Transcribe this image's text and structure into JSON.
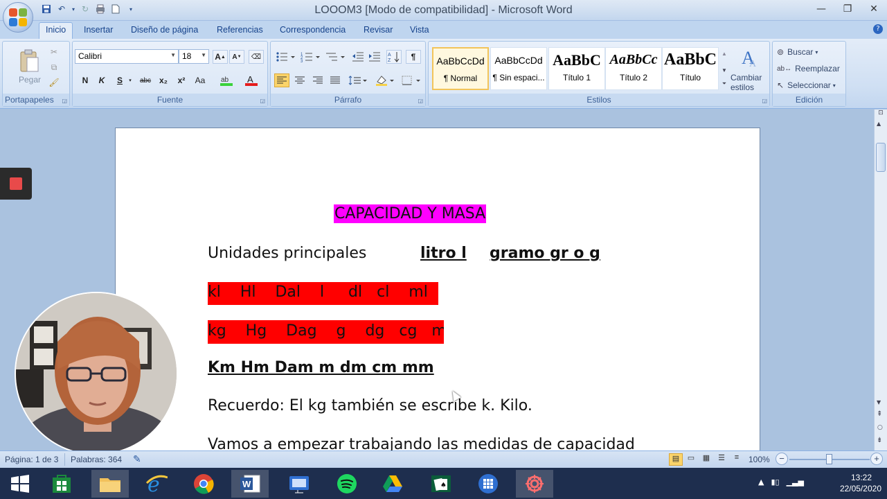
{
  "window": {
    "title": "LOOOM3 [Modo de compatibilidad] - Microsoft Word",
    "controls": [
      "minimize-icon",
      "restore-icon",
      "close-icon"
    ]
  },
  "qat": {
    "icons": [
      "save-icon",
      "undo-icon",
      "redo-icon",
      "print-icon",
      "new-doc-icon",
      "customize-icon"
    ]
  },
  "tabs": [
    "Inicio",
    "Insertar",
    "Diseño de página",
    "Referencias",
    "Correspondencia",
    "Revisar",
    "Vista"
  ],
  "active_tab": "Inicio",
  "ribbon": {
    "portapapeles": {
      "label": "Portapapeles",
      "paste": "Pegar"
    },
    "fuente": {
      "label": "Fuente",
      "font_name": "Calibri",
      "font_size": "18",
      "buttons": [
        "N",
        "K",
        "S",
        "abc",
        "x₂",
        "x²",
        "Aa"
      ]
    },
    "parrafo": {
      "label": "Párrafo"
    },
    "estilos": {
      "label": "Estilos",
      "items": [
        {
          "sample": "AaBbCcDd",
          "name": "¶ Normal"
        },
        {
          "sample": "AaBbCcDd",
          "name": "¶ Sin espaci..."
        },
        {
          "sample": "AaBbC",
          "name": "Título 1"
        },
        {
          "sample": "AaBbCc",
          "name": "Título 2"
        },
        {
          "sample": "AaBbC",
          "name": "Título"
        }
      ],
      "change_styles": "Cambiar estilos"
    },
    "edicion": {
      "label": "Edición",
      "find": "Buscar",
      "replace": "Reemplazar",
      "select": "Seleccionar"
    }
  },
  "document": {
    "title": "CAPACIDAD Y MASA",
    "unidades_label": "Unidades principales",
    "litro": "litro l",
    "gramo": "gramo gr o g",
    "capacity_row": "kl    Hl    Dal    l     dl   cl    ml",
    "mass_row": "kg    Hg    Dag    g    dg   cg   ml",
    "length_row": "Km Hm Dam m dm cm mm",
    "recuerdo": "Recuerdo: El kg también se escribe k. Kilo.",
    "next_line": "Vamos a empezar trabajando las medidas de capacidad"
  },
  "status": {
    "page": "Página: 1 de 3",
    "words": "Palabras: 364",
    "zoom": "100%"
  },
  "taskbar": {
    "apps": [
      "windows-start-icon",
      "store-icon",
      "file-explorer-icon",
      "internet-explorer-icon",
      "chrome-icon",
      "word-icon",
      "presentation-icon",
      "spotify-icon",
      "google-drive-icon",
      "solitaire-icon",
      "calculator-grid-icon",
      "loom-icon"
    ],
    "time": "13:22",
    "date": "22/05/2020"
  },
  "colors": {
    "title_highlight": "#ff00ff",
    "row_highlight": "#ff0000",
    "ribbon_bg": "#dbe7f6",
    "taskbar_bg": "#1e2e4e"
  }
}
